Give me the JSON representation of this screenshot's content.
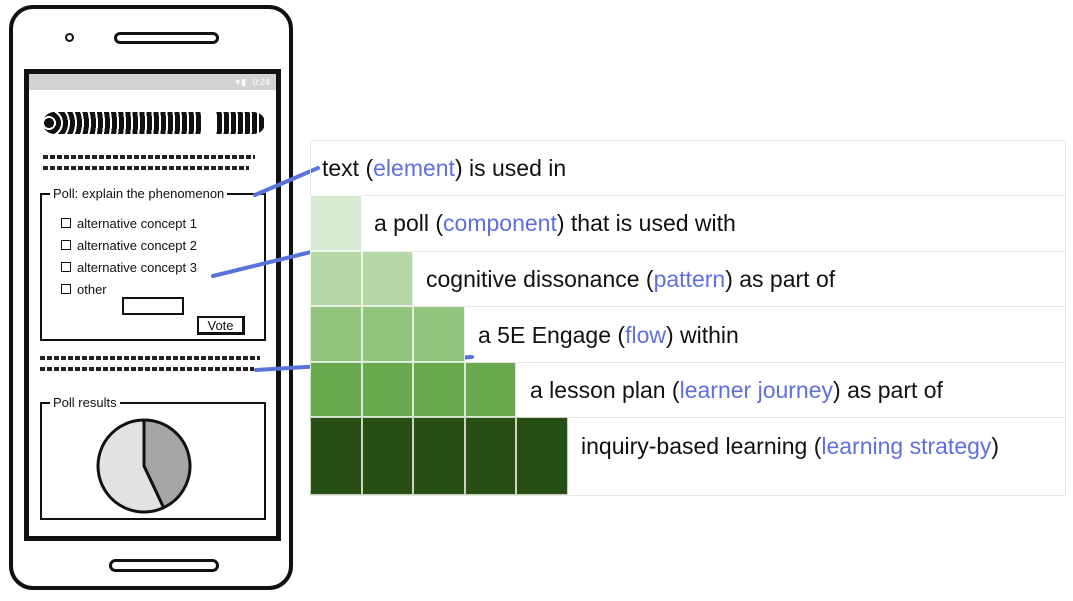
{
  "phone": {
    "status_time": "0:24",
    "poll": {
      "legend": "Poll: explain the phenomenon",
      "options": [
        "alternative concept 1",
        "alternative concept 2",
        "alternative concept 3",
        "other"
      ],
      "vote_label": "Vote"
    },
    "results": {
      "legend": "Poll results",
      "pie": {
        "shares": [
          0.43,
          0.57
        ],
        "colors": [
          "#a6a6a6",
          "#e2e2e2"
        ]
      }
    }
  },
  "levels": [
    {
      "pre": "text (",
      "kw": "element",
      "post": ") is used in",
      "color": ""
    },
    {
      "pre": "a poll (",
      "kw": "component",
      "post": ") that is used with",
      "color": "#d9ead3"
    },
    {
      "pre": "cognitive dissonance (",
      "kw": "pattern",
      "post": ") as part of",
      "color": "#b6d7a8"
    },
    {
      "pre": "a 5E Engage (",
      "kw": "flow",
      "post": ") within",
      "color": "#93c47d"
    },
    {
      "pre": "a lesson plan (",
      "kw": "learner journey",
      "post": ") as part of",
      "color": "#6aa84f"
    },
    {
      "pre": "inquiry-based learning (",
      "kw": "learning strategy",
      "post": ")",
      "color": "#274e13"
    }
  ],
  "colors": {
    "keyword": "#5f6fde",
    "connector": "#5a73d9"
  }
}
